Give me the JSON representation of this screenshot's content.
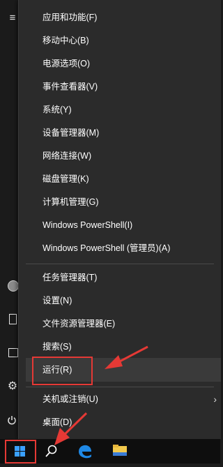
{
  "menu": {
    "items": [
      {
        "label": "应用和功能(F)"
      },
      {
        "label": "移动中心(B)"
      },
      {
        "label": "电源选项(O)"
      },
      {
        "label": "事件查看器(V)"
      },
      {
        "label": "系统(Y)"
      },
      {
        "label": "设备管理器(M)"
      },
      {
        "label": "网络连接(W)"
      },
      {
        "label": "磁盘管理(K)"
      },
      {
        "label": "计算机管理(G)"
      },
      {
        "label": "Windows PowerShell(I)"
      },
      {
        "label": "Windows PowerShell (管理员)(A)"
      }
    ],
    "items2": [
      {
        "label": "任务管理器(T)"
      },
      {
        "label": "设置(N)"
      },
      {
        "label": "文件资源管理器(E)"
      },
      {
        "label": "搜索(S)"
      },
      {
        "label": "运行(R)"
      }
    ],
    "items3": [
      {
        "label": "关机或注销(U)"
      },
      {
        "label": "桌面(D)"
      }
    ]
  },
  "strip": {
    "hamburger": "≡",
    "icons": [
      "hamburger-icon",
      "user-avatar",
      "document-icon",
      "image-icon",
      "gear-icon",
      "power-icon"
    ]
  },
  "taskbar": {
    "icons": [
      "windows-logo-icon",
      "search-icon",
      "edge-icon",
      "file-explorer-icon"
    ]
  },
  "colors": {
    "menu_bg": "#2b2b2b",
    "taskbar_bg": "#0e0e0e",
    "annotation_red": "#e53935",
    "edge_blue": "#1e88e5",
    "explorer_yellow": "#f2c94c"
  }
}
